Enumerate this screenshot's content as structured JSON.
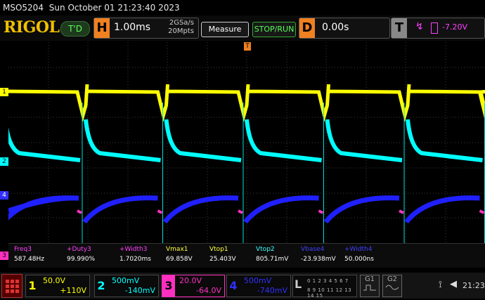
{
  "status": {
    "model": "MSO5204",
    "datetime": "Sun October 01 21:23:40 2023"
  },
  "top": {
    "logo": "RIGOL",
    "run_state": "T'D",
    "horizontal": {
      "key": "H",
      "timebase": "1.00ms",
      "rate": "2GSa/s",
      "depth": "20Mpts"
    },
    "measure_label": "Measure",
    "stoprun_label": "STOP/RUN",
    "delay": {
      "key": "D",
      "value": "0.00s"
    },
    "trigger": {
      "key": "T",
      "level": "-7.20V"
    }
  },
  "trigger_marker": "T",
  "channel_markers": [
    "1",
    "2",
    "4",
    "3"
  ],
  "measurements": [
    {
      "label": "Freq3",
      "value": "587.48Hz",
      "color": "#ff40ff"
    },
    {
      "label": "+Duty3",
      "value": "99.990%",
      "color": "#ff40ff"
    },
    {
      "label": "+Width3",
      "value": "1.7020ms",
      "color": "#ff40ff"
    },
    {
      "label": "Vmax1",
      "value": "69.858V",
      "color": "#ffff40"
    },
    {
      "label": "Vtop1",
      "value": "25.403V",
      "color": "#ffff40"
    },
    {
      "label": "Vtop2",
      "value": "805.71mV",
      "color": "#40ffff"
    },
    {
      "label": "Vbase4",
      "value": "-23.938mV",
      "color": "#4040ff"
    },
    {
      "label": "+Width4",
      "value": "50.000ns",
      "color": "#4040ff"
    }
  ],
  "channels": [
    {
      "n": "1",
      "scale": "50.0V",
      "offset": "+110V",
      "color": "#ffff00"
    },
    {
      "n": "2",
      "scale": "500mV",
      "offset": "-140mV",
      "color": "#00ffff"
    },
    {
      "n": "3",
      "scale": "20.0V",
      "offset": "-64.0V",
      "color": "#ff30c0"
    },
    {
      "n": "4",
      "scale": "500mV",
      "offset": "-740mV",
      "color": "#3030ff"
    }
  ],
  "la": {
    "key": "L",
    "row1": "0 1 2 3 4 5 6 7",
    "row2": "8 9 10 11 12 13 14 15"
  },
  "gen": [
    "G1",
    "G2"
  ],
  "clock": "21:23"
}
